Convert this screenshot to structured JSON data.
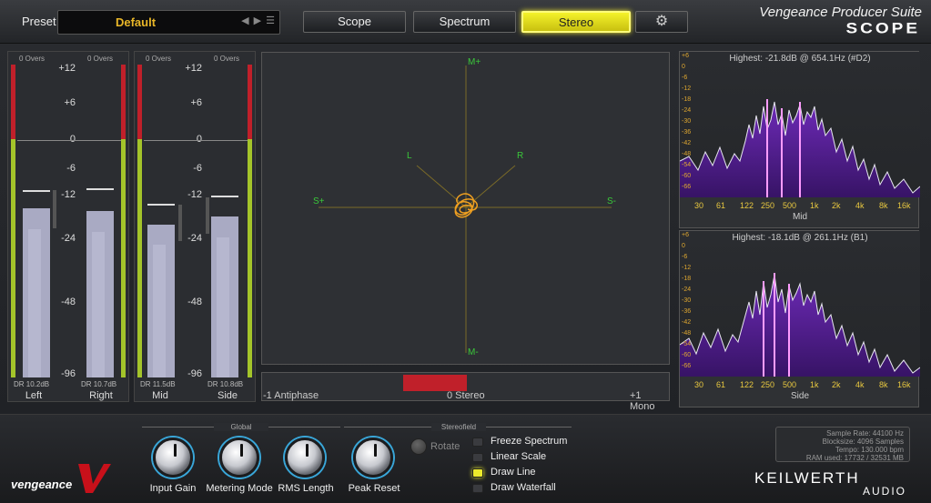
{
  "header": {
    "preset_label": "Preset",
    "preset_name": "Default",
    "tabs": [
      {
        "label": "Scope"
      },
      {
        "label": "Spectrum"
      },
      {
        "label": "Stereo",
        "active": true
      }
    ],
    "brand_line1": "Vengeance Producer Suite",
    "brand_line2": "SCOPE"
  },
  "meters": {
    "overs_label": "0 Overs",
    "scale": [
      "+12",
      "+6",
      "0",
      "-6",
      "-12",
      "-24",
      "-48",
      "-96"
    ],
    "channels": [
      {
        "name": "Left",
        "dr": "DR 10.2dB"
      },
      {
        "name": "Right",
        "dr": "DR 10.7dB"
      },
      {
        "name": "Mid",
        "dr": "DR 11.5dB"
      },
      {
        "name": "Side",
        "dr": "DR 10.8dB"
      }
    ]
  },
  "stereo": {
    "labels": {
      "top": "M+",
      "bottom": "M-",
      "left": "S+",
      "right": "S-",
      "l": "L",
      "r": "R"
    },
    "correlation": {
      "left": "-1 Antiphase",
      "center": "0 Stereo",
      "right": "+1 Mono"
    }
  },
  "spectrum": {
    "db_labels": [
      "+6",
      "0",
      "-6",
      "-12",
      "-18",
      "-24",
      "-30",
      "-36",
      "-42",
      "-48",
      "-54",
      "-60",
      "-66"
    ],
    "freq_labels": [
      "30",
      "61",
      "122",
      "250",
      "500",
      "1k",
      "2k",
      "4k",
      "8k",
      "16k"
    ],
    "panels": [
      {
        "highest": "Highest: -21.8dB @ 654.1Hz (#D2)",
        "name": "Mid"
      },
      {
        "highest": "Highest: -18.1dB @ 261.1Hz (B1)",
        "name": "Side"
      }
    ]
  },
  "controls": {
    "global_title": "Global",
    "stereofield_title": "Stereofield",
    "knobs": [
      {
        "label": "Input Gain"
      },
      {
        "label": "Metering Mode"
      },
      {
        "label": "RMS Length"
      },
      {
        "label": "Peak Reset"
      }
    ],
    "rotate_label": "Rotate",
    "checkboxes": [
      {
        "label": "Freeze Spectrum",
        "checked": false
      },
      {
        "label": "Linear Scale",
        "checked": false
      },
      {
        "label": "Draw Line",
        "checked": true
      },
      {
        "label": "Draw Waterfall",
        "checked": false
      }
    ]
  },
  "info": {
    "sample_rate": "Sample Rate: 44100 Hz",
    "blocksize": "Blocksize: 4096 Samples",
    "tempo": "Tempo: 130.000 bpm",
    "ram": "RAM used: 17732 / 32531 MB"
  },
  "footer": {
    "vengeance_logo": "vengeance",
    "keilwerth": "KEILWERTH",
    "audio": "AUDIO"
  },
  "colors": {
    "accent": "#f0e830",
    "green": "#3ac83a",
    "red": "#c0202a",
    "spectrum_fill": "#8a2ac8"
  }
}
